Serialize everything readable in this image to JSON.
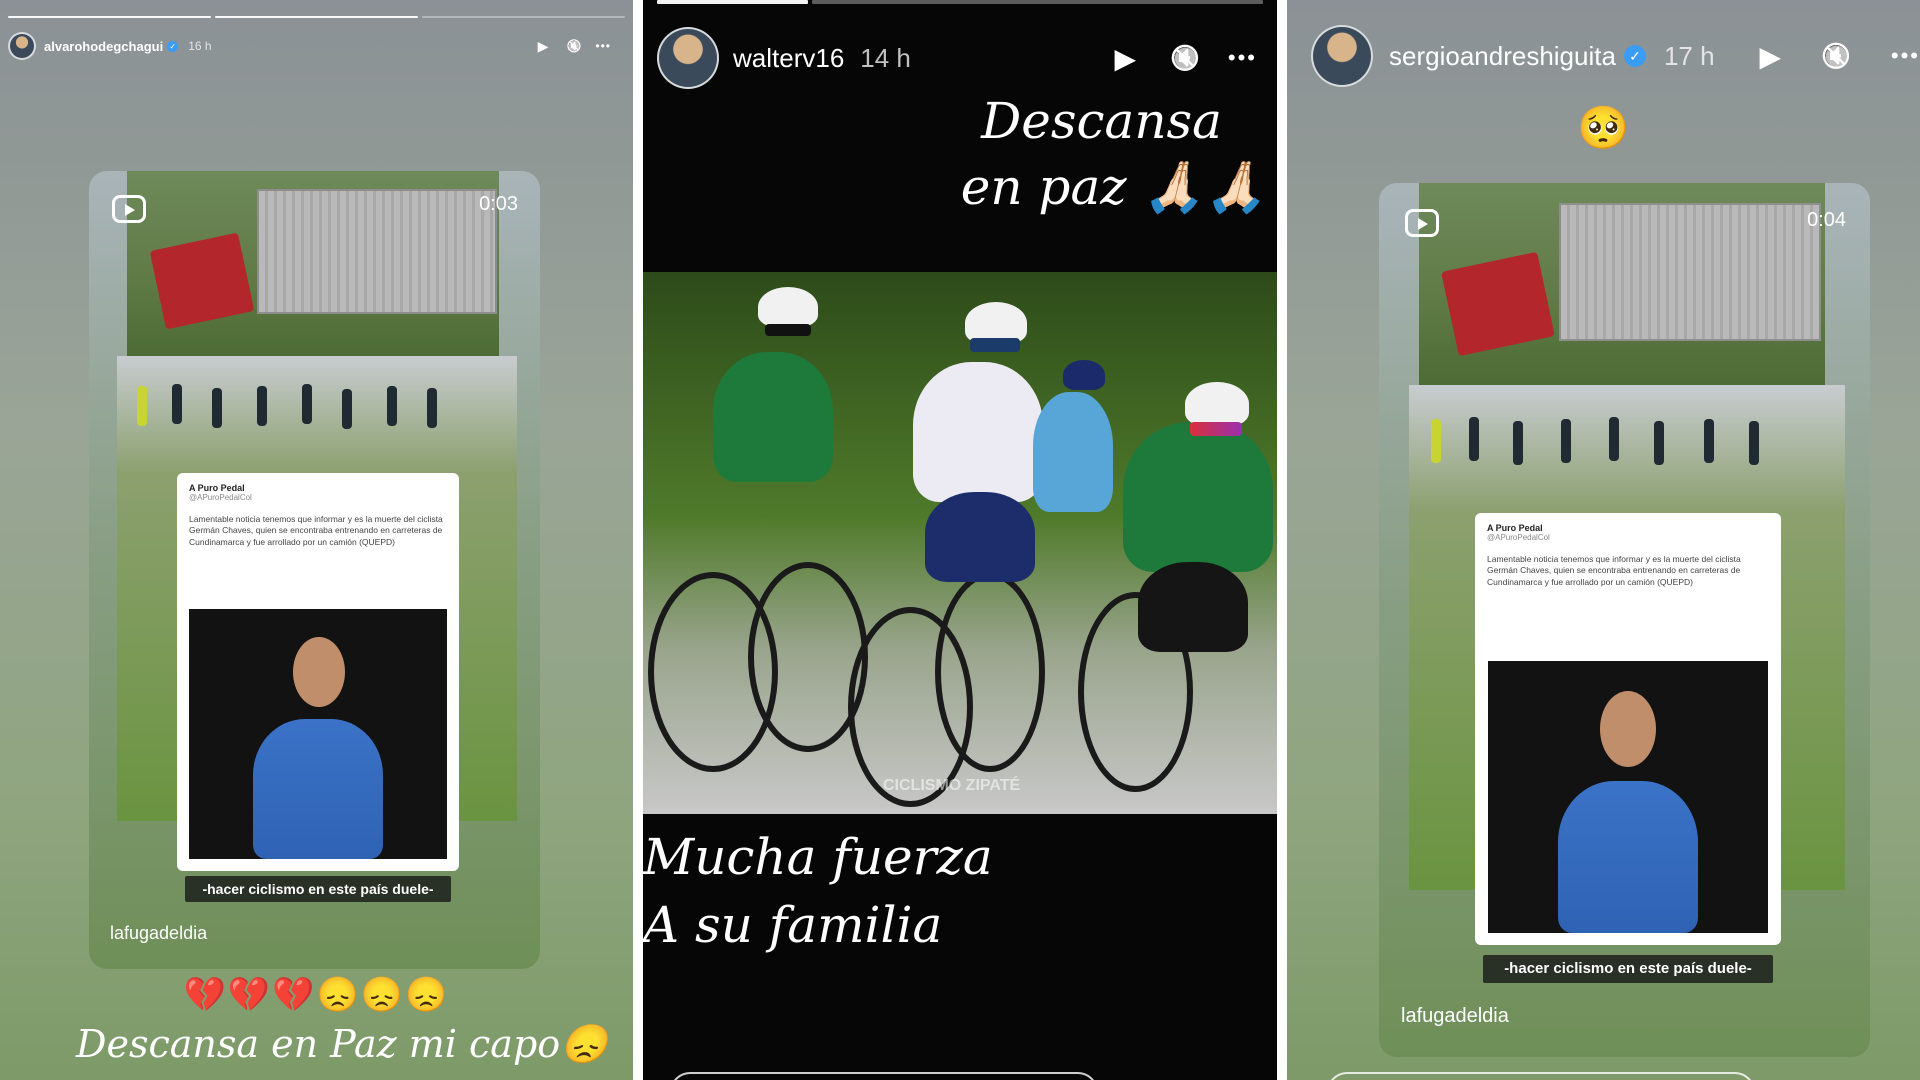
{
  "stories": [
    {
      "username": "alvarohodegchagui",
      "verified": true,
      "time": "16 h",
      "repost": {
        "reel_time": "0:03",
        "tweet_user": "A Puro Pedal",
        "tweet_handle": "@APuroPedalCol",
        "tweet_text": "Lamentable noticia tenemos que informar y es la muerte del ciclista Germán Chaves, quien se encontraba entrenando en carreteras de Cundinamarca y fue arrollado por un camión (QUEPD)",
        "caption": "-hacer ciclismo en este país duele-",
        "watermark": "lafugadeldia"
      },
      "emojis": "💔💔💔😞😞😞",
      "bottom_text": "Descansa en Paz mi capo😞"
    },
    {
      "username": "walterv16",
      "verified": false,
      "time": "14 h",
      "top_text_line1": "Descansa",
      "top_text_line2": "en paz 🙏🏻🙏🏻",
      "photo_watermark": "CICLISMO ZIPATÉ",
      "bottom_text_line1": "Mucha fuerza",
      "bottom_text_line2": "A su familia"
    },
    {
      "username": "sergioandreshiguita",
      "verified": true,
      "time": "17 h",
      "top_emoji": "🥺",
      "repost": {
        "reel_time": "0:04",
        "tweet_user": "A Puro Pedal",
        "tweet_handle": "@APuroPedalCol",
        "tweet_text": "Lamentable noticia tenemos que informar y es la muerte del ciclista Germán Chaves, quien se encontraba entrenando en carreteras de Cundinamarca y fue arrollado por un camión (QUEPD)",
        "caption": "-hacer ciclismo en este país duele-",
        "watermark": "lafugadeldia"
      }
    }
  ],
  "icons": {
    "play": "▶",
    "mute": "🔇",
    "more": "•••",
    "verified": "✓"
  },
  "colors": {
    "verified_blue": "#3b9cf6",
    "broken_heart_red": "#c51f2e"
  }
}
